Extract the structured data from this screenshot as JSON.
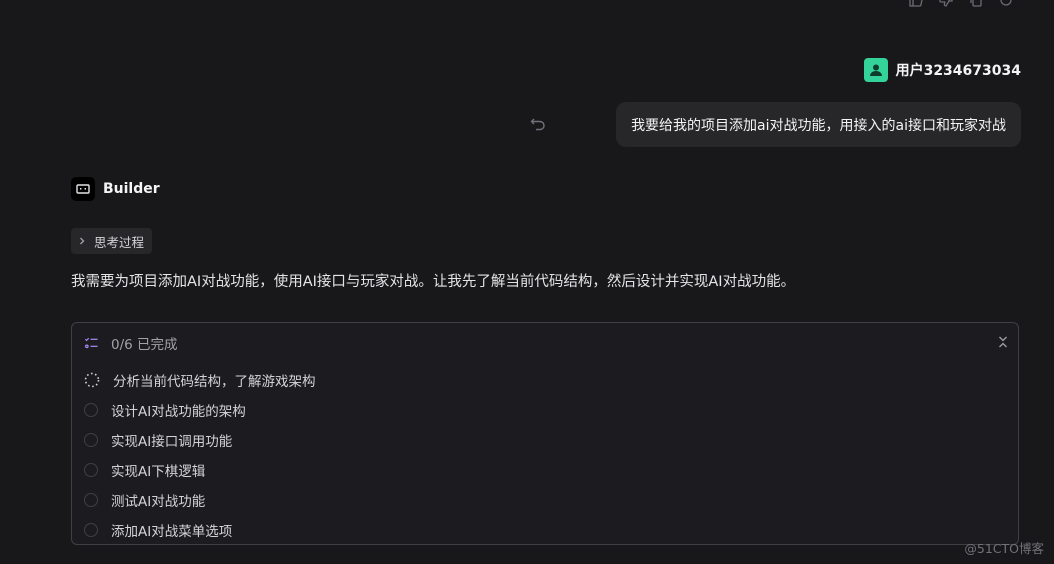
{
  "toolbar": {
    "icons": [
      "thumbs-up-icon",
      "thumbs-down-icon",
      "copy-icon",
      "refresh-icon"
    ]
  },
  "user": {
    "name": "用户3234673034",
    "avatar_color": "#34d399"
  },
  "user_message": {
    "text": "我要给我的项目添加ai对战功能，用接入的ai接口和玩家对战"
  },
  "bot": {
    "name": "Builder"
  },
  "thinking": {
    "label": "思考过程"
  },
  "reply": {
    "text": "我需要为项目添加AI对战功能，使用AI接口与玩家对战。让我先了解当前代码结构，然后设计并实现AI对战功能。"
  },
  "tasks": {
    "progress": "0/6 已完成",
    "items": [
      {
        "label": "分析当前代码结构，了解游戏架构",
        "status": "in-progress"
      },
      {
        "label": "设计AI对战功能的架构",
        "status": "pending"
      },
      {
        "label": "实现AI接口调用功能",
        "status": "pending"
      },
      {
        "label": "实现AI下棋逻辑",
        "status": "pending"
      },
      {
        "label": "测试AI对战功能",
        "status": "pending"
      },
      {
        "label": "添加AI对战菜单选项",
        "status": "pending"
      }
    ]
  },
  "watermark": "@51CTO博客",
  "colors": {
    "background": "#18181b",
    "bubble": "#27272a",
    "border": "#3f3f46",
    "accent": "#34d399"
  }
}
